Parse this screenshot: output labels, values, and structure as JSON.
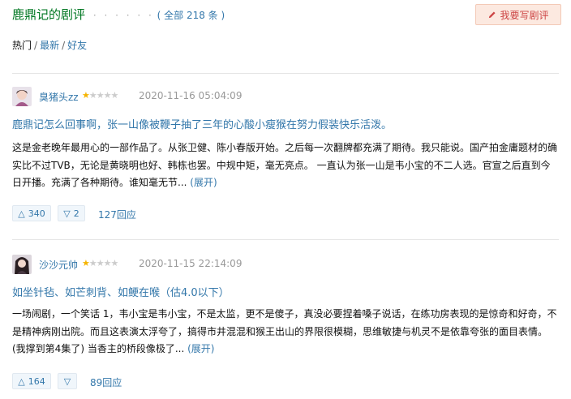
{
  "header": {
    "title": "鹿鼎记的剧评",
    "dots": "· · · · · ·",
    "count": "( 全部 218 条 )",
    "write_button": "我要写剧评"
  },
  "filters": [
    "热门",
    "最新",
    "好友"
  ],
  "filter_sep": "/",
  "reviews": [
    {
      "author": "臭猪头zz",
      "stars": "★★★★★",
      "rating_stars": 1,
      "time": "2020-11-16 05:04:09",
      "title": "鹿鼎记怎么回事啊，张一山像被鞭子抽了三年的心酸小瘦猴在努力假装快乐活泼。",
      "body": "这是金老晚年最用心的一部作品了。从张卫健、陈小春版开始。之后每一次翻牌都充满了期待。我只能说。国产拍金庸题材的确实比不过TVB，无论是黄晓明也好、韩栋也罢。中规中矩，毫无亮点。 一直认为张一山是韦小宝的不二人选。官宣之后直到今日开播。充满了各种期待。谁知毫无节...",
      "expand": "(展开)",
      "up": "340",
      "down": "2",
      "replies": "127回应"
    },
    {
      "author": "沙沙元帅",
      "stars": "★★★★★",
      "rating_stars": 1,
      "time": "2020-11-15 22:14:09",
      "title": "如坐针毡、如芒刺背、如鲠在喉（估4.0以下）",
      "body": "一场闹剧，一个笑话 1，韦小宝是韦小宝，不是太监，更不是傻子，真没必要捏着嗓子说话，在练功房表现的是惊奇和好奇，不是精神病刚出院。而且这表演太浮夸了，搞得市井混混和猴王出山的界限很模糊，思维敏捷与机灵不是依靠夸张的面目表情。 (我撑到第4集了) 当香主的桥段像极了...",
      "expand": "(展开)",
      "up": "164",
      "down": "",
      "replies": "89回应"
    }
  ],
  "icons": {
    "write": "pencil-icon",
    "up": "thumb-up-triangle-icon",
    "down": "thumb-down-triangle-icon"
  },
  "colors": {
    "title_green": "#007722",
    "link_blue": "#3377aa",
    "star_gold": "#f5b400",
    "write_bg": "#fce9e0",
    "write_text": "#cc4444"
  }
}
